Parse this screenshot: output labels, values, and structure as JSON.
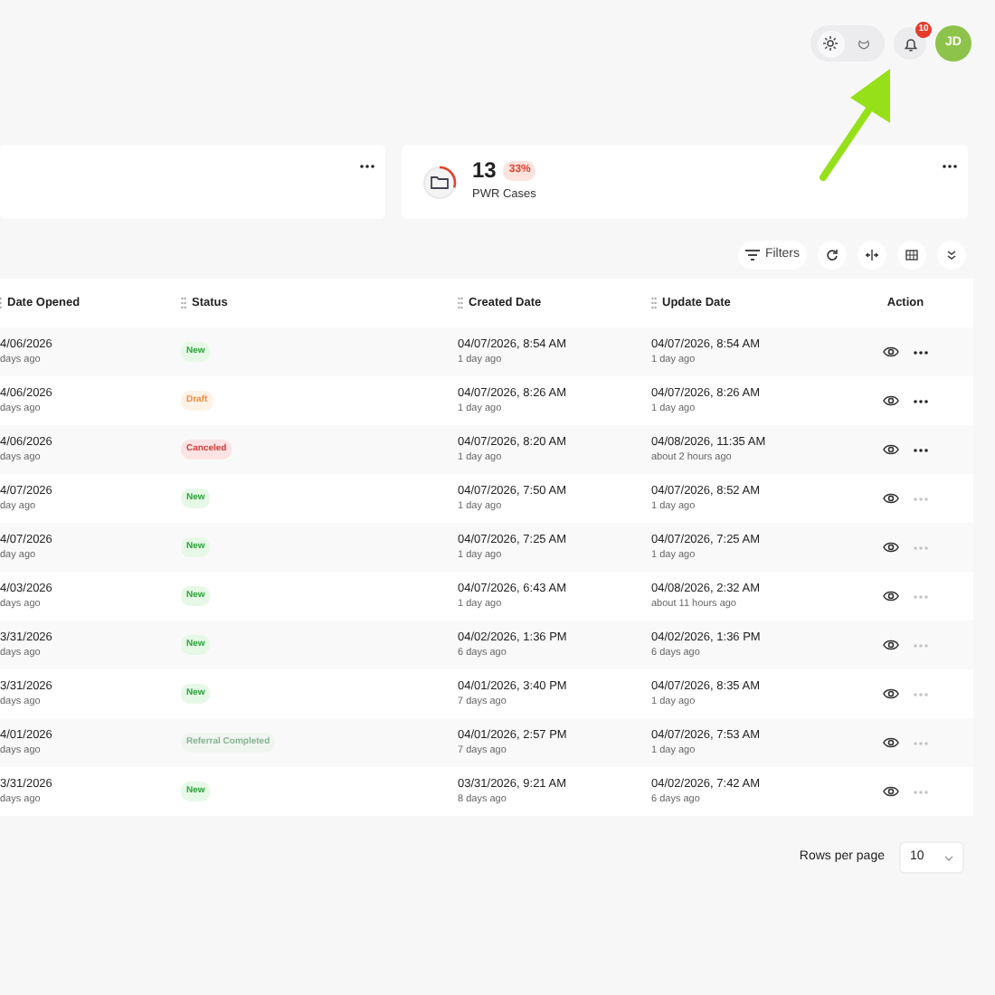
{
  "header": {
    "theme_toggle": [
      {
        "kind": "sun",
        "selected": true
      },
      {
        "kind": "moon",
        "selected": false
      }
    ],
    "notifications": {
      "count": "10"
    },
    "avatar": {
      "initials": "JD"
    }
  },
  "cards": [
    {
      "kind": "empty"
    },
    {
      "kind": "stat",
      "value": "13",
      "change": "33%",
      "label": "PWR Cases",
      "level": 0.3
    }
  ],
  "toolbar": {
    "filters": "Filters"
  },
  "table": {
    "columns": [
      "Date Opened",
      "Status",
      "Created Date",
      "Update Date",
      "Action"
    ],
    "rows": [
      {
        "opened": "4/06/2026",
        "opened_ago": "days ago",
        "status": {
          "label": "New",
          "kind": "new"
        },
        "created": "04/07/2026, 8:54 AM",
        "created_ago": "1 day ago",
        "updated": "04/07/2026, 8:54 AM",
        "updated_ago": "1 day ago",
        "menu_disabled": false
      },
      {
        "opened": "4/06/2026",
        "opened_ago": "days ago",
        "status": {
          "label": "Draft",
          "kind": "draft"
        },
        "created": "04/07/2026, 8:26 AM",
        "created_ago": "1 day ago",
        "updated": "04/07/2026, 8:26 AM",
        "updated_ago": "1 day ago",
        "menu_disabled": false
      },
      {
        "opened": "4/06/2026",
        "opened_ago": "days ago",
        "status": {
          "label": "Canceled",
          "kind": "canceled"
        },
        "created": "04/07/2026, 8:20 AM",
        "created_ago": "1 day ago",
        "updated": "04/08/2026, 11:35 AM",
        "updated_ago": "about 2 hours ago",
        "menu_disabled": false
      },
      {
        "opened": "4/07/2026",
        "opened_ago": "day ago",
        "status": {
          "label": "New",
          "kind": "new"
        },
        "created": "04/07/2026, 7:50 AM",
        "created_ago": "1 day ago",
        "updated": "04/07/2026, 8:52 AM",
        "updated_ago": "1 day ago",
        "menu_disabled": true
      },
      {
        "opened": "4/07/2026",
        "opened_ago": "day ago",
        "status": {
          "label": "New",
          "kind": "new"
        },
        "created": "04/07/2026, 7:25 AM",
        "created_ago": "1 day ago",
        "updated": "04/07/2026, 7:25 AM",
        "updated_ago": "1 day ago",
        "menu_disabled": true
      },
      {
        "opened": "4/03/2026",
        "opened_ago": "days ago",
        "status": {
          "label": "New",
          "kind": "new"
        },
        "created": "04/07/2026, 6:43 AM",
        "created_ago": "1 day ago",
        "updated": "04/08/2026, 2:32 AM",
        "updated_ago": "about 11 hours ago",
        "menu_disabled": true
      },
      {
        "opened": "3/31/2026",
        "opened_ago": "days ago",
        "status": {
          "label": "New",
          "kind": "new"
        },
        "created": "04/02/2026, 1:36 PM",
        "created_ago": "6 days ago",
        "updated": "04/02/2026, 1:36 PM",
        "updated_ago": "6 days ago",
        "menu_disabled": true
      },
      {
        "opened": "3/31/2026",
        "opened_ago": "days ago",
        "status": {
          "label": "New",
          "kind": "new"
        },
        "created": "04/01/2026, 3:40 PM",
        "created_ago": "7 days ago",
        "updated": "04/07/2026, 8:35 AM",
        "updated_ago": "1 day ago",
        "menu_disabled": true
      },
      {
        "opened": "4/01/2026",
        "opened_ago": "days ago",
        "status": {
          "label": "Referral Completed",
          "kind": "referral"
        },
        "created": "04/01/2026, 2:57 PM",
        "created_ago": "7 days ago",
        "updated": "04/07/2026, 7:53 AM",
        "updated_ago": "1 day ago",
        "menu_disabled": true
      },
      {
        "opened": "3/31/2026",
        "opened_ago": "days ago",
        "status": {
          "label": "New",
          "kind": "new"
        },
        "created": "03/31/2026, 9:21 AM",
        "created_ago": "8 days ago",
        "updated": "04/02/2026, 7:42 AM",
        "updated_ago": "6 days ago",
        "menu_disabled": true
      }
    ]
  },
  "pagination": {
    "label": "Rows per page",
    "value": "10"
  }
}
